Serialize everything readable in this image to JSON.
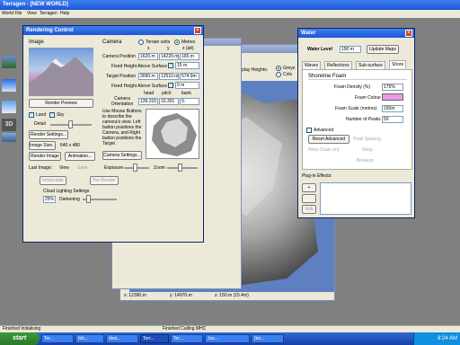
{
  "app": {
    "title": "Terragen - [NEW WORLD]",
    "menu": [
      "World File",
      "View",
      "Terragen",
      "Help"
    ]
  },
  "rendering": {
    "title": "Rendering Control",
    "image_label": "Image",
    "render_preview": "Render Preview",
    "land": "Land",
    "sky": "Sky",
    "detail": "Detail",
    "render_settings": "Render Settings...",
    "image_size": "Image Size...",
    "size_value": "640 x 480",
    "render_image": "Render Image",
    "animation": "Animation...",
    "last_image": "Last Image:",
    "view": "View",
    "save": "Save",
    "camera_label": "Camera",
    "terrain_units": "Terrain units",
    "metres": "Metres",
    "col_x": "x",
    "col_y": "y",
    "col_z": "z (alt)",
    "camera_position": "Camera Position",
    "cam_x": "1620.m",
    "cam_y": "14220.m",
    "cam_z": "165.m",
    "fixed_height_1": "Fixed Height Above Surface",
    "fixed_val_1": "15 m",
    "target_position": "Target Position",
    "tgt_x": "3090.m",
    "tgt_y": "12510.m",
    "tgt_z": "574.9m",
    "fixed_height_2": "Fixed Height Above Surface",
    "fixed_val_2": "0 m",
    "col_head": "head",
    "col_pitch": "pitch",
    "col_bank": "bank",
    "camera_orientation": "Camera Orientation",
    "head": "139.316",
    "pitch": "10.301",
    "bank": "0.",
    "help_text": "Use Mouse Buttons to describe the camera's view. Left button positions the Camera, and Right button positions the Target",
    "camera_settings": "Camera Settings...",
    "exposure": "Exposure",
    "zoom": "Zoom",
    "interpolate": "Interpolate",
    "pre_render": "Pre-Render",
    "cloud_lighting": "Cloud Lighting Settings",
    "cloud_pct": "25%",
    "darkening": "Darkening"
  },
  "landscape": {
    "display_heights": "Display Heights:",
    "greys": "Greys",
    "cols": "Cols",
    "status_x": "x: 12390.m",
    "status_y": "y: 14970.m",
    "status_z": "z: 150.m (15.4m)"
  },
  "water": {
    "title": "Water",
    "water_level_label": "Water Level",
    "water_level": "150 m",
    "update_maps": "Update Maps",
    "tabs": [
      "Waves",
      "Reflections",
      "Sub-surface",
      "Shore"
    ],
    "shoreline_foam": "Shoreline Foam",
    "foam_density_label": "Foam Density (%)",
    "foam_density": "175%",
    "foam_colour_label": "Foam Colour",
    "foam_colour": "#e89ae8",
    "foam_scale_label": "Foam Scale (metres)",
    "foam_scale": "150m",
    "num_peaks_label": "Number of Peaks",
    "num_peaks": "50",
    "advanced": "Advanced",
    "reset_advanced": "Reset Advanced",
    "peak_spacing": "Peak Spacing",
    "warp_scale": "Warp Scale (m)",
    "warp": "Warp",
    "breakup": "Breakup",
    "plugin_effects": "Plug-in Effects:",
    "add": "+",
    "remove": "-",
    "edit": "Edit"
  },
  "statusbar": {
    "left": "Finished Initialising",
    "right": "Finished Calling MHC"
  },
  "taskbar": {
    "start": "start",
    "clock": "8:24 AM",
    "items": [
      "Ter...",
      "fsh...",
      "desi...",
      "Terr...",
      "Ter...",
      "Jus...",
      "(ter..."
    ]
  }
}
